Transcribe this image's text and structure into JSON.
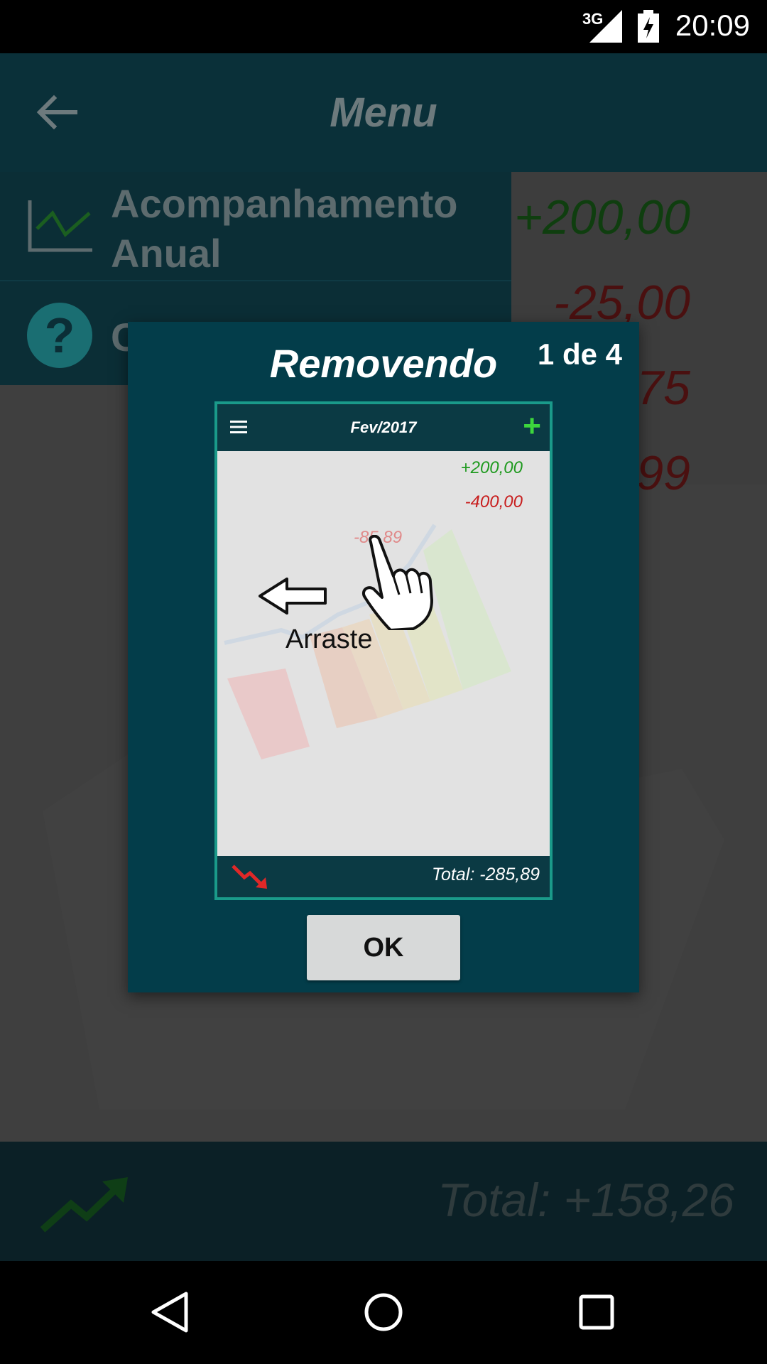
{
  "status_bar": {
    "network": "3G",
    "time": "20:09"
  },
  "app_bar": {
    "title": "Menu"
  },
  "menu": {
    "items": [
      {
        "label": "Acompanhamento Anual",
        "icon": "line-chart-icon"
      },
      {
        "label": "C",
        "icon": "help-icon"
      }
    ]
  },
  "background_values": [
    "+200,00",
    "-25,00",
    "75",
    "99"
  ],
  "bottom_bar": {
    "total": "Total:  +158,26",
    "icon": "trend-up-icon"
  },
  "dialog": {
    "title": "Removendo",
    "page_indicator": "1 de 4",
    "preview": {
      "title": "Fev/2017",
      "values": [
        "+200,00",
        "-400,00",
        "-85,89"
      ],
      "instruction": "Arraste",
      "total": "Total:  -285,89"
    },
    "ok_label": "OK"
  },
  "colors": {
    "dialog_bg": "#033d4a",
    "preview_border": "#1a9a8a",
    "positive": "#1f9a1f",
    "negative": "#c81e1e",
    "add_green": "#3dd63d"
  }
}
